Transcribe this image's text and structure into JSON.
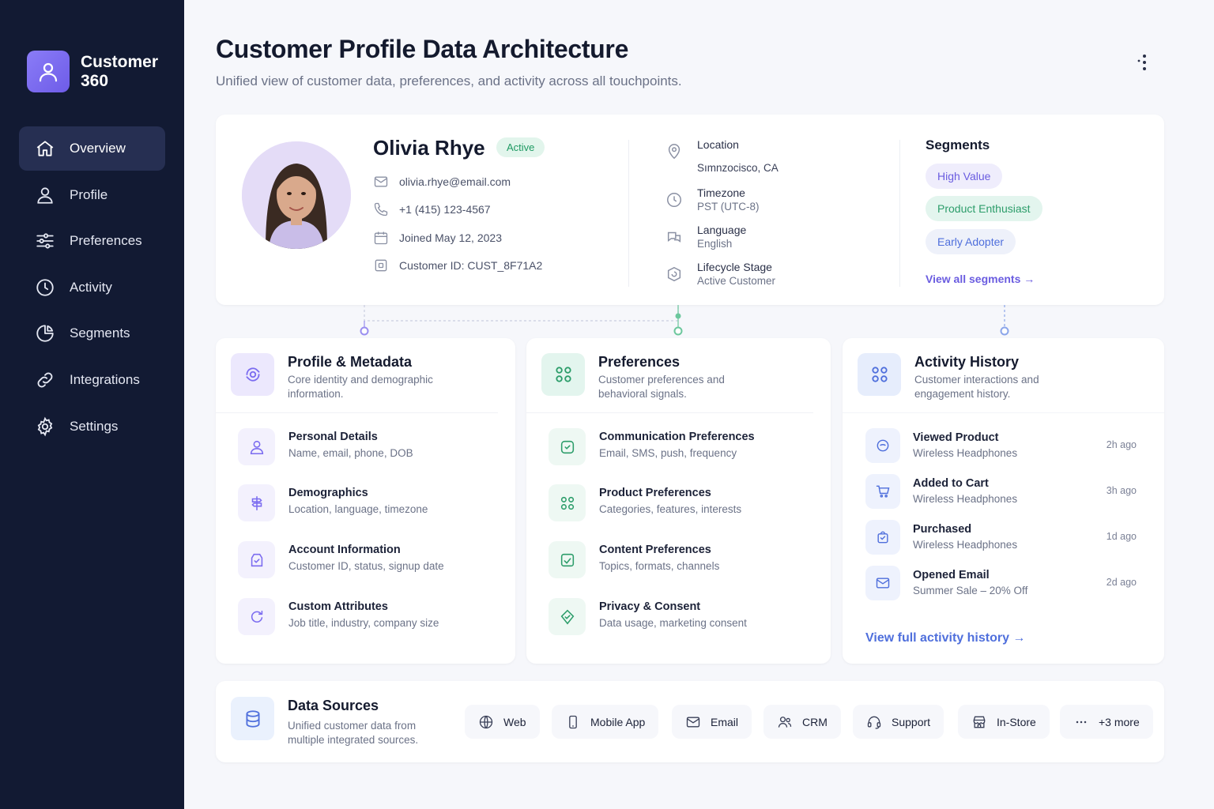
{
  "app": {
    "brand_name": "Customer 360"
  },
  "sidebar": {
    "items": [
      {
        "label": "Overview",
        "icon": "home-icon",
        "active": true
      },
      {
        "label": "Profile",
        "icon": "user-icon"
      },
      {
        "label": "Preferences",
        "icon": "sliders-icon"
      },
      {
        "label": "Activity",
        "icon": "clock-icon"
      },
      {
        "label": "Segments",
        "icon": "pie-chart-icon"
      },
      {
        "label": "Integrations",
        "icon": "link-icon"
      },
      {
        "label": "Settings",
        "icon": "gear-icon"
      }
    ]
  },
  "header": {
    "title": "Customer Profile Data Architecture",
    "subtitle": "Unified view of customer data, preferences, and activity across all touchpoints."
  },
  "profile": {
    "name": "Olivia Rhye",
    "status": "Active",
    "email": "olivia.rhye@email.com",
    "phone": "+1 (415) 123-4567",
    "joined": "Joined May 12, 2023",
    "customer_id": "Customer ID: CUST_8F71A2",
    "location_label": "Location",
    "location_value": "Sımnzocisco, CA",
    "timezone_label": "Timezone",
    "timezone_value": "PST (UTC-8)",
    "language_label": "Language",
    "language_value": "English",
    "lifecycle_label": "Lifecycle Stage",
    "lifecycle_value": "Active Customer"
  },
  "segments": {
    "title": "Segments",
    "items": [
      "High Value",
      "Product Enthusiast",
      "Early Adopter"
    ],
    "link": "View all segments →"
  },
  "profile_metadata": {
    "title": "Profile & Metadata",
    "description": "Core identity and demographic information.",
    "items": [
      {
        "title": "Personal Details",
        "desc": "Name, email, phone, DOB"
      },
      {
        "title": "Demographics",
        "desc": "Location, language, timezone"
      },
      {
        "title": "Account Information",
        "desc": "Customer ID, status, signup date"
      },
      {
        "title": "Custom Attributes",
        "desc": "Job title, industry, company size"
      }
    ]
  },
  "preferences": {
    "title": "Preferences",
    "description": "Customer preferences and behavioral signals.",
    "items": [
      {
        "title": "Communication Preferences",
        "desc": "Email, SMS, push, frequency"
      },
      {
        "title": "Product Preferences",
        "desc": "Categories, features, interests"
      },
      {
        "title": "Content Preferences",
        "desc": "Topics, formats, channels"
      },
      {
        "title": "Privacy & Consent",
        "desc": "Data usage, marketing consent"
      }
    ]
  },
  "activity": {
    "title": "Activity History",
    "description": "Customer interactions and engagement history.",
    "items": [
      {
        "title": "Viewed Product",
        "desc": "Wireless Headphones",
        "time": "2h ago"
      },
      {
        "title": "Added to Cart",
        "desc": "Wireless Headphones",
        "time": "3h ago"
      },
      {
        "title": "Purchased",
        "desc": "Wireless Headphones",
        "time": "1d ago"
      },
      {
        "title": "Opened Email",
        "desc": "Summer Sale – 20% Off",
        "time": "2d ago"
      }
    ],
    "link": "View full activity history →"
  },
  "data_sources": {
    "title": "Data Sources",
    "description": "Unified customer data from multiple integrated sources.",
    "chips": [
      "Web",
      "Mobile App",
      "Email",
      "CRM",
      "Support",
      "In-Store",
      "+3 more"
    ]
  },
  "colors": {
    "sidebar_bg": "#121a33",
    "accent_purple": "#7b6cf0",
    "accent_green": "#1f9a63",
    "accent_blue": "#4f6fdc"
  }
}
